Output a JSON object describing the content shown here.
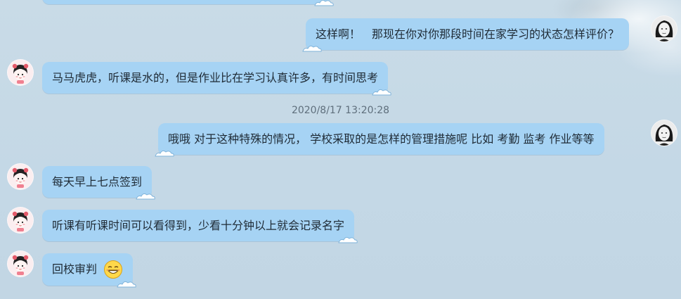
{
  "conversation": {
    "messages": [
      {
        "sender": "me",
        "text": "这样啊！　那现在你对你那段时间在家学习的状态怎样评价？"
      },
      {
        "sender": "contact",
        "text": "马马虎虎，听课是水的，但是作业比在学习认真许多，有时间思考"
      },
      {
        "sender": "me",
        "text": "哦哦  对于这种特殊的情况， 学校采取的是怎样的管理措施呢  比如 考勤  监考  作业等等"
      },
      {
        "sender": "contact",
        "text": "每天早上七点签到"
      },
      {
        "sender": "contact",
        "text": "听课有听课时间可以看得到，少看十分钟以上就会记录名字"
      },
      {
        "sender": "contact",
        "text": "回校审判",
        "emoji": "grin-emoji"
      }
    ],
    "timestamp": "2020/8/17 13:20:28"
  },
  "colors": {
    "bubble": "#a6d3f4",
    "background": "#c4d8e6",
    "text": "#1f2b36",
    "timestamp": "#5f6f7c"
  },
  "icons": {
    "contact_avatar": "cartoon-girl-avatar",
    "me_avatar": "woman-portrait-avatar",
    "bubble_decoration": "cloud-icon"
  }
}
